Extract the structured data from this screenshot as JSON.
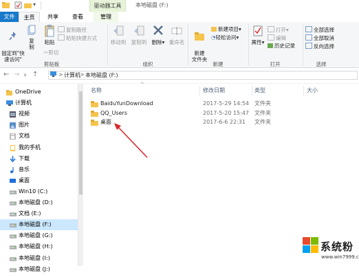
{
  "window": {
    "title": "本地磁盘 (F:)",
    "context_tab_group": "驱动器工具"
  },
  "tabs": {
    "file": "文件",
    "home": "主页",
    "share": "共享",
    "view": "查看",
    "manage": "管理"
  },
  "ribbon": {
    "pin_quick_access": "固定到\"快\n速访问\"",
    "copy": "复制",
    "paste": "粘贴",
    "copy_path": "复制路径",
    "paste_shortcut": "粘贴快捷方式",
    "cut": "剪切",
    "clipboard_group": "剪贴板",
    "move_to": "移动到",
    "copy_to": "复制到",
    "delete": "删除",
    "rename": "重命名",
    "organize_group": "组织",
    "new_folder": "新建\n文件夹",
    "new_item": "新建项目",
    "easy_access": "轻松访问",
    "new_group": "新建",
    "properties": "属性",
    "open": "打开",
    "edit": "编辑",
    "history": "历史记录",
    "open_group": "打开",
    "select_all": "全部选择",
    "select_none": "全部取消",
    "invert_selection": "反向选择",
    "select_group": "选择"
  },
  "address": {
    "crumbs": [
      "计算机",
      "本地磁盘 (F:)"
    ],
    "sep": ">"
  },
  "nav": {
    "items": [
      {
        "label": "OneDrive",
        "icon": "folder-icon",
        "indent": 0
      },
      {
        "label": "计算机",
        "icon": "computer-icon",
        "indent": 0
      },
      {
        "label": "视频",
        "icon": "video-icon",
        "indent": 1
      },
      {
        "label": "图片",
        "icon": "picture-icon",
        "indent": 1
      },
      {
        "label": "文档",
        "icon": "document-icon",
        "indent": 1
      },
      {
        "label": "我的手机",
        "icon": "phone-icon",
        "indent": 1
      },
      {
        "label": "下载",
        "icon": "download-icon",
        "indent": 1
      },
      {
        "label": "音乐",
        "icon": "music-icon",
        "indent": 1
      },
      {
        "label": "桌面",
        "icon": "desktop-icon",
        "indent": 1
      },
      {
        "label": "Win10 (C:)",
        "icon": "drive-icon",
        "indent": 1
      },
      {
        "label": "本地磁盘 (D:)",
        "icon": "drive-icon",
        "indent": 1
      },
      {
        "label": "文档 (E:)",
        "icon": "drive-icon",
        "indent": 1
      },
      {
        "label": "本地磁盘 (F:)",
        "icon": "drive-icon",
        "indent": 1,
        "selected": true
      },
      {
        "label": "本地磁盘 (G:)",
        "icon": "drive-icon",
        "indent": 1
      },
      {
        "label": "本地磁盘 (H:)",
        "icon": "drive-icon",
        "indent": 1
      },
      {
        "label": "本地磁盘 (I:)",
        "icon": "drive-icon",
        "indent": 1
      },
      {
        "label": "本地磁盘 (J:)",
        "icon": "drive-icon",
        "indent": 1
      }
    ]
  },
  "columns": {
    "name": "名称",
    "date": "修改日期",
    "type": "类型",
    "size": "大小"
  },
  "files": [
    {
      "name": "BaiduYunDownload",
      "date": "2017-5-29 14:54",
      "type": "文件夹"
    },
    {
      "name": "QQ_Users",
      "date": "2017-5-20 15:47",
      "type": "文件夹"
    },
    {
      "name": "桌面",
      "date": "2017-6-6 22:31",
      "type": "文件夹"
    }
  ],
  "watermark": {
    "text": "系统粉",
    "url": "www.win7999.com"
  },
  "colors": {
    "file_tab": "#1979ca",
    "selection": "#cce8ff",
    "folder": "#f5c44d",
    "arrow": "#d9262c"
  }
}
